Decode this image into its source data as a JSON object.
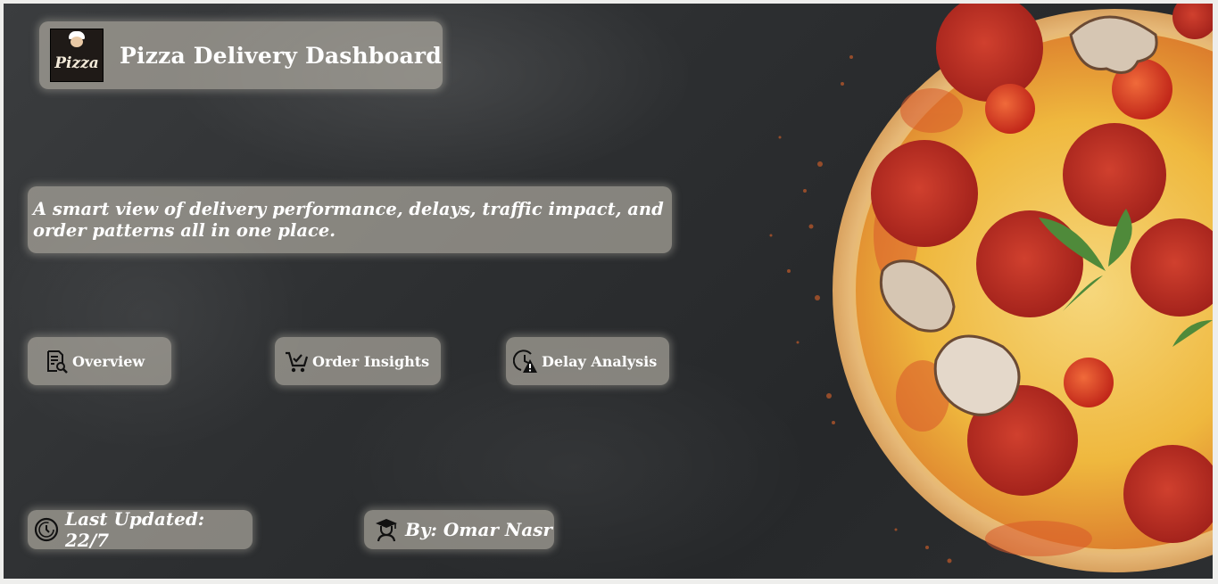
{
  "header": {
    "logo_text": "Pizza",
    "title": "Pizza Delivery Dashboard"
  },
  "subtitle": "A smart view of delivery performance, delays, traffic impact, and order patterns all in one place.",
  "nav": {
    "overview_label": "Overview",
    "order_insights_label": "Order Insights",
    "delay_analysis_label": "Delay Analysis"
  },
  "footer": {
    "last_updated": "Last Updated: 22/7",
    "author": "By: Omar Nasr"
  },
  "icons": {
    "overview": "document-search-icon",
    "order_insights": "cart-check-icon",
    "delay_analysis": "clock-warning-icon",
    "last_updated": "refresh-clock-icon",
    "author": "graduate-user-icon"
  },
  "colors": {
    "background": "#2d2f31",
    "pill": "#bfb9af",
    "text": "#ffffff",
    "crust": "#e6b877",
    "sauce": "#c7401c",
    "pepperoni": "#b8291e",
    "cheese": "#f2c044"
  }
}
